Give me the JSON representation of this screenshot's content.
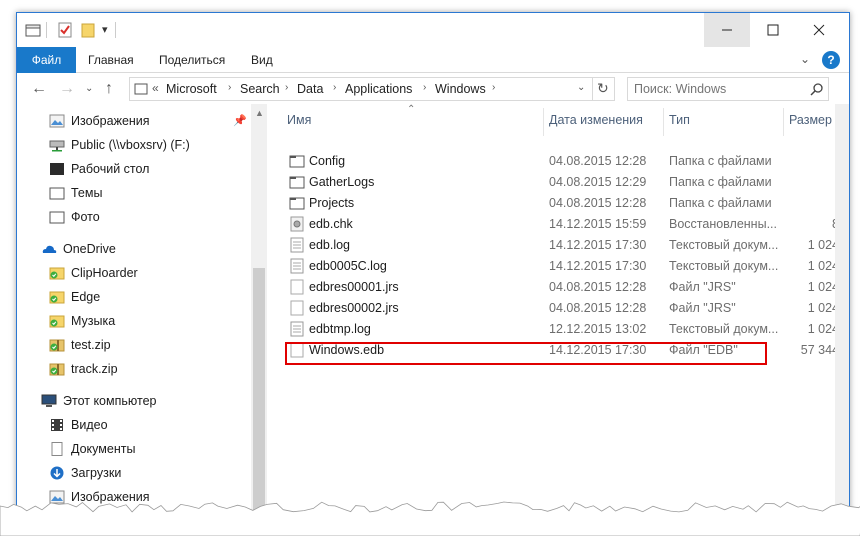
{
  "ribbon": {
    "tabs": [
      "Файл",
      "Главная",
      "Поделиться",
      "Вид"
    ]
  },
  "address": {
    "crumbs": [
      "Microsoft",
      "Search",
      "Data",
      "Applications",
      "Windows"
    ],
    "search_placeholder": "Поиск: Windows"
  },
  "nav": {
    "items": [
      {
        "label": "Изображения",
        "icon": "pictures-icon",
        "pinned": true
      },
      {
        "label": "Public (\\\\vboxsrv) (F:)",
        "icon": "network-drive-icon"
      },
      {
        "label": "Рабочий стол",
        "icon": "desktop-icon"
      },
      {
        "label": "Темы",
        "icon": "folder-icon"
      },
      {
        "label": "Фото",
        "icon": "folder-icon"
      },
      {
        "label": "OneDrive",
        "icon": "onedrive-icon"
      },
      {
        "label": "ClipHoarder",
        "icon": "synced-folder-icon"
      },
      {
        "label": "Edge",
        "icon": "synced-folder-icon"
      },
      {
        "label": "Музыка",
        "icon": "synced-folder-icon"
      },
      {
        "label": "test.zip",
        "icon": "synced-zip-icon"
      },
      {
        "label": "track.zip",
        "icon": "synced-zip-icon"
      },
      {
        "label": "Этот компьютер",
        "icon": "computer-icon"
      },
      {
        "label": "Видео",
        "icon": "video-icon"
      },
      {
        "label": "Документы",
        "icon": "documents-icon"
      },
      {
        "label": "Загрузки",
        "icon": "downloads-icon"
      },
      {
        "label": "Изображения",
        "icon": "pictures-icon"
      }
    ]
  },
  "columns": {
    "name": "Имя",
    "date": "Дата изменения",
    "type": "Тип",
    "size": "Размер"
  },
  "files": [
    {
      "name": "Config",
      "date": "04.08.2015 12:28",
      "type": "Папка с файлами",
      "size": "",
      "icon": "folder-icon"
    },
    {
      "name": "GatherLogs",
      "date": "04.08.2015 12:29",
      "type": "Папка с файлами",
      "size": "",
      "icon": "folder-icon"
    },
    {
      "name": "Projects",
      "date": "04.08.2015 12:28",
      "type": "Папка с файлами",
      "size": "",
      "icon": "folder-icon"
    },
    {
      "name": "edb.chk",
      "date": "14.12.2015 15:59",
      "type": "Восстановленны...",
      "size": "8",
      "icon": "system-file-icon"
    },
    {
      "name": "edb.log",
      "date": "14.12.2015 17:30",
      "type": "Текстовый докум...",
      "size": "1 024",
      "icon": "text-file-icon"
    },
    {
      "name": "edb0005C.log",
      "date": "14.12.2015 17:30",
      "type": "Текстовый докум...",
      "size": "1 024",
      "icon": "text-file-icon"
    },
    {
      "name": "edbres00001.jrs",
      "date": "04.08.2015 12:28",
      "type": "Файл \"JRS\"",
      "size": "1 024",
      "icon": "blank-file-icon"
    },
    {
      "name": "edbres00002.jrs",
      "date": "04.08.2015 12:28",
      "type": "Файл \"JRS\"",
      "size": "1 024",
      "icon": "blank-file-icon"
    },
    {
      "name": "edbtmp.log",
      "date": "12.12.2015 13:02",
      "type": "Текстовый докум...",
      "size": "1 024",
      "icon": "text-file-icon"
    },
    {
      "name": "Windows.edb",
      "date": "14.12.2015 17:30",
      "type": "Файл \"EDB\"",
      "size": "57 344",
      "icon": "blank-file-icon"
    }
  ],
  "colors": {
    "accent": "#1979ca",
    "highlight": "#e00000",
    "folder": "#e8c25a"
  }
}
